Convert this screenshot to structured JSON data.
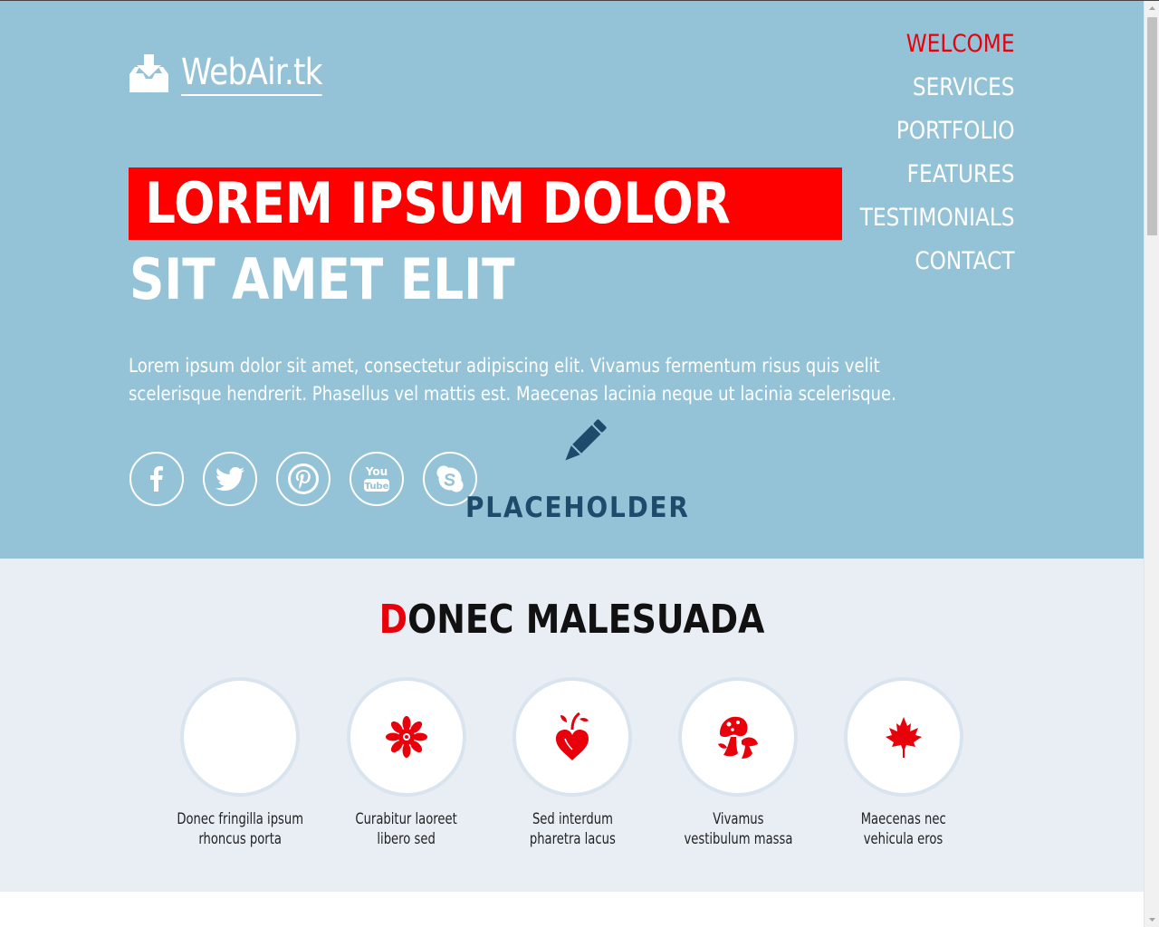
{
  "header": {
    "logo_text": "WebAir.tk",
    "logo_icon": "download-tray-icon"
  },
  "nav": {
    "items": [
      {
        "label": "WELCOME",
        "active": true
      },
      {
        "label": "SERVICES",
        "active": false
      },
      {
        "label": "PORTFOLIO",
        "active": false
      },
      {
        "label": "FEATURES",
        "active": false
      },
      {
        "label": "TESTIMONIALS",
        "active": false
      },
      {
        "label": "CONTACT",
        "active": false
      }
    ]
  },
  "hero": {
    "headline_line1": "LOREM IPSUM DOLOR",
    "headline_line2": "SIT AMET ELIT",
    "intro_text": "Lorem ipsum dolor sit amet, consectetur adipiscing elit. Vivamus fermentum risus quis velit scelerisque hendrerit. Phasellus vel mattis est. Maecenas lacinia neque ut lacinia scelerisque.",
    "socials": [
      "facebook-icon",
      "twitter-icon",
      "pinterest-icon",
      "youtube-icon",
      "skype-icon"
    ],
    "placeholder_text": "PLACEHOLDER",
    "placeholder_icon": "pencil-icon"
  },
  "services": {
    "title_first_letter": "D",
    "title_rest": "ONEC MALESUADA",
    "features": [
      {
        "label_line1": "Donec fringilla ipsum",
        "label_line2": "rhoncus porta",
        "icon": "empty"
      },
      {
        "label_line1": "Curabitur laoreet",
        "label_line2": "libero sed",
        "icon": "flower-icon"
      },
      {
        "label_line1": "Sed interdum",
        "label_line2": "pharetra lacus",
        "icon": "heart-vine-icon"
      },
      {
        "label_line1": "Vivamus",
        "label_line2": "vestibulum massa",
        "icon": "mushroom-icon"
      },
      {
        "label_line1": "Maecenas nec",
        "label_line2": "vehicula eros",
        "icon": "maple-leaf-icon"
      }
    ]
  },
  "colors": {
    "hero_bg": "#94c3d7",
    "accent_red": "#ff0000",
    "services_bg": "#e9eef5",
    "placeholder_blue": "#1e4b6b"
  }
}
